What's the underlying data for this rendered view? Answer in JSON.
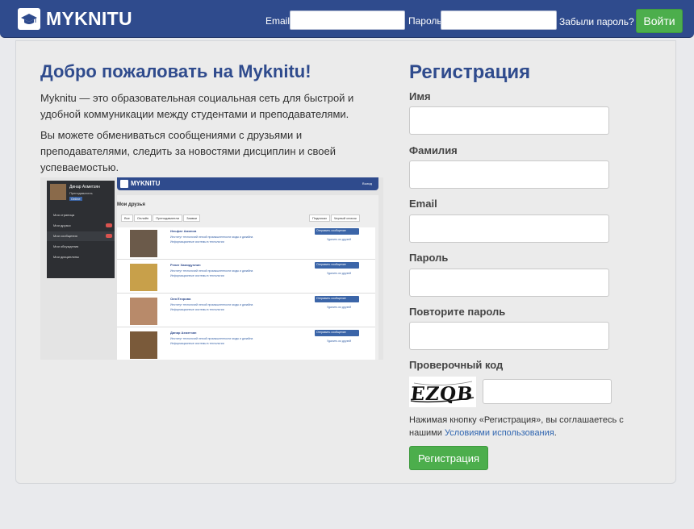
{
  "header": {
    "brand": "MYKNITU",
    "email_label": "Email",
    "email_value": "",
    "password_label": "Пароль",
    "password_value": "",
    "forgot_link": "Забыли пароль?",
    "login_button": "Войти",
    "brand_color": "#2f4b8d"
  },
  "intro": {
    "title": "Добро пожаловать на Myknitu!",
    "paragraph1": "Myknitu — это образовательная социальная сеть для быстрой и удобной коммуникации между студентами и преподавателями.",
    "paragraph2": "Вы можете обмениваться сообщениями с друзьями и преподавателями, следить за новостями дисциплин и своей успеваемостью."
  },
  "preview": {
    "brand": "MYKNITU",
    "exit": "Выход",
    "user_name": "Динар Ахметзян",
    "user_role": "Преподаватель",
    "online": "Online",
    "menu": [
      {
        "label": "Моя страница"
      },
      {
        "label": "Мои друзья"
      },
      {
        "label": "Мои сообщения"
      },
      {
        "label": "Мои обсуждения"
      },
      {
        "label": "Мои дисциплины"
      }
    ],
    "heading": "Мои друзья",
    "tabs": [
      "Все",
      "Онлайн",
      "Преподаватели",
      "Заявки"
    ],
    "right_tabs": [
      "Подписки",
      "Черный список"
    ],
    "friends": [
      {
        "name": "Ильфат Аминов",
        "desc": "Институт технологий легкой промышленности моды и дизайна Информационные системы в технологии"
      },
      {
        "name": "Ренат Хамидуллин",
        "desc": "Институт технологий легкой промышленности моды и дизайна Информационные системы в технологии"
      },
      {
        "name": "Оля Егорова",
        "desc": "Институт технологий легкой промышленности моды и дизайна Информационные системы в технологии"
      },
      {
        "name": "Динар Ахметзян",
        "desc": "Институт технологий легкой промышленности моды и дизайна Информационные системы в технологии"
      }
    ],
    "send_message": "Отправить сообщение",
    "remove_friend": "Удалить из друзей"
  },
  "registration": {
    "title": "Регистрация",
    "first_name_label": "Имя",
    "first_name_value": "",
    "last_name_label": "Фамилия",
    "last_name_value": "",
    "email_label": "Email",
    "email_value": "",
    "password_label": "Пароль",
    "password_value": "",
    "password_repeat_label": "Повторите пароль",
    "password_repeat_value": "",
    "captcha_label": "Проверочный код",
    "captcha_text": "EZQB",
    "captcha_value": "",
    "terms_prefix": "Нажимая кнопку «Регистрация», вы соглашаетесь с нашими",
    "terms_link": "Условиями использования",
    "terms_suffix": ".",
    "submit": "Регистрация",
    "button_color": "#4cae4c"
  }
}
